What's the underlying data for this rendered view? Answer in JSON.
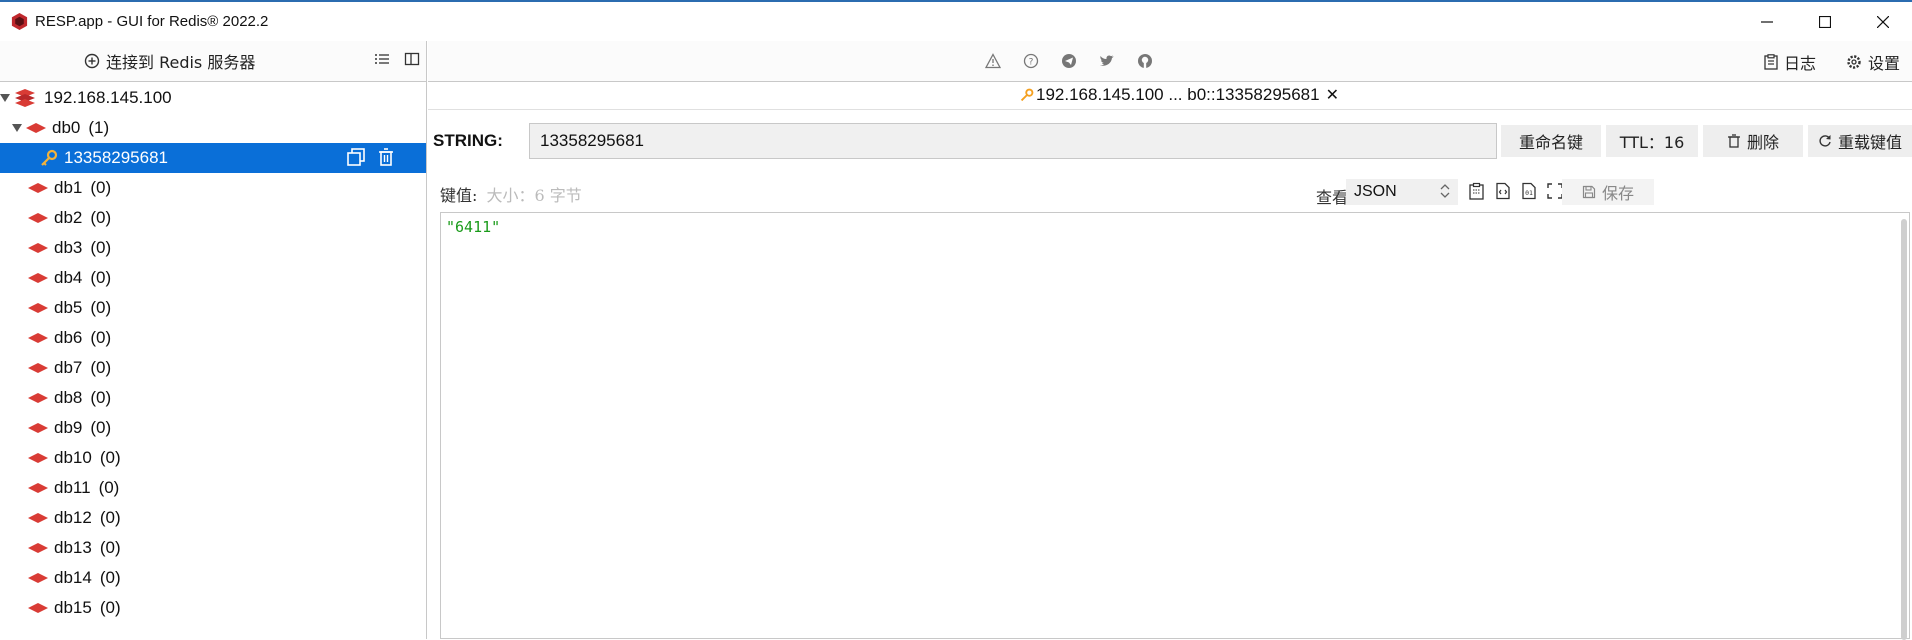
{
  "window": {
    "title": "RESP.app - GUI for Redis® 2022.2"
  },
  "left_toolbar": {
    "connect_label": "连接到 Redis 服务器"
  },
  "tree": {
    "server": "192.168.145.100",
    "databases": [
      {
        "name": "db0",
        "count": "(1)",
        "expanded": true
      },
      {
        "name": "db1",
        "count": "(0)"
      },
      {
        "name": "db2",
        "count": "(0)"
      },
      {
        "name": "db3",
        "count": "(0)"
      },
      {
        "name": "db4",
        "count": "(0)"
      },
      {
        "name": "db5",
        "count": "(0)"
      },
      {
        "name": "db6",
        "count": "(0)"
      },
      {
        "name": "db7",
        "count": "(0)"
      },
      {
        "name": "db8",
        "count": "(0)"
      },
      {
        "name": "db9",
        "count": "(0)"
      },
      {
        "name": "db10",
        "count": "(0)"
      },
      {
        "name": "db11",
        "count": "(0)"
      },
      {
        "name": "db12",
        "count": "(0)"
      },
      {
        "name": "db13",
        "count": "(0)"
      },
      {
        "name": "db14",
        "count": "(0)"
      },
      {
        "name": "db15",
        "count": "(0)"
      }
    ],
    "selected_key": "13358295681"
  },
  "top_right": {
    "log_label": "日志",
    "settings_label": "设置"
  },
  "tab": {
    "label": "192.168.145.100 ... b0::13358295681",
    "close": "✕"
  },
  "key": {
    "type": "STRING:",
    "name": "13358295681",
    "rename_label": "重命名键",
    "ttl_label": "TTL：16",
    "delete_label": "删除",
    "reload_label": "重载键值"
  },
  "value": {
    "label": "键值:",
    "size": "大小：6 字节",
    "view_label": "查看",
    "view_mode": "JSON",
    "save_label": "保存",
    "content": "\"6411\""
  },
  "colors": {
    "selection": "#0a6fd8",
    "db_icon": "#d93b35",
    "string_value": "#1a9b1a"
  }
}
